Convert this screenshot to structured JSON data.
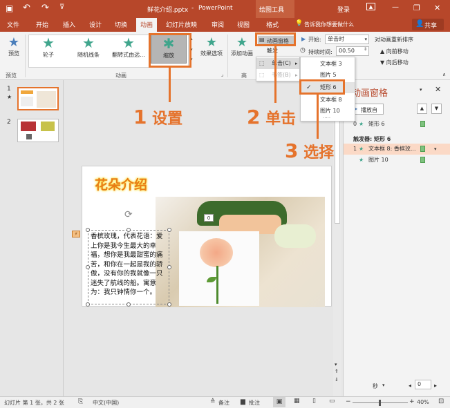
{
  "titlebar": {
    "filename": "鲜花介绍.pptx",
    "sep": "-",
    "app": "PowerPoint",
    "context_tool": "绘图工具",
    "login": "登录",
    "min": "—",
    "restore": "❐",
    "close": "✕",
    "save_icon": "▣",
    "undo": "↶",
    "redo": "↷"
  },
  "tabs": [
    {
      "label": "文件"
    },
    {
      "label": "开始"
    },
    {
      "label": "插入"
    },
    {
      "label": "设计"
    },
    {
      "label": "切换"
    },
    {
      "label": "动画"
    },
    {
      "label": "幻灯片放映"
    },
    {
      "label": "审阅"
    },
    {
      "label": "视图"
    },
    {
      "label": "格式"
    }
  ],
  "tell_me": "告诉我你想要做什么",
  "share": "共享",
  "ribbon": {
    "preview": "预览",
    "preview_group": "预览",
    "gallery": [
      {
        "label": "轮子",
        "color": "#3fa58c"
      },
      {
        "label": "随机线条",
        "color": "#3fa58c"
      },
      {
        "label": "翻转式由远...",
        "color": "#3fa58c"
      },
      {
        "label": "缩放",
        "color": "#3fa58c"
      }
    ],
    "effect_options": "效果选项",
    "anim_group": "动画",
    "add_anim": "添加动画",
    "adv_group": "高",
    "anim_pane_btn": "动画窗格",
    "trigger_btn": "触发",
    "start_label": "开始:",
    "start_value": "单击时",
    "duration_label": "持续时间:",
    "duration_value": "00.50",
    "reorder": "对动画重新排序",
    "move_earlier": "向前移动",
    "move_later": "向后移动"
  },
  "menu": {
    "on_click": "单击(C)",
    "bookmark": "书签(B)",
    "sub_items": [
      {
        "label": "文本框 3"
      },
      {
        "label": "图片 5"
      },
      {
        "label": "矩形 6"
      },
      {
        "label": "文本框 8"
      },
      {
        "label": "图片 10"
      }
    ],
    "more": "....."
  },
  "annotations": {
    "step1_num": "1",
    "step1_text": "设置",
    "step2_num": "2",
    "step2_text": "单击",
    "step3_num": "3",
    "step3_text": "选择"
  },
  "thumbs": {
    "slide1_num": "1",
    "slide1_star": "★",
    "slide2_num": "2"
  },
  "slide": {
    "title": "花朵介绍",
    "anim_tag": "0",
    "text": "香槟玫瑰，代表花语：爱上你是我今生最大的幸福，想你是我最甜蜜的痛苦，和你在一起是我的骄傲，没有你的我就像一只迷失了航线的船。寓意为：我只钟情你一个。"
  },
  "anim_pane": {
    "title": "动画窗格",
    "play_from": "播放自",
    "item0_num": "0",
    "item0_label": "矩形 6",
    "trigger_header": "触发器: 矩形 6",
    "item1_num": "1",
    "item1_label": "文本框 8: 香槟玫...",
    "item2_label": "图片 10",
    "seconds": "秒",
    "page_value": "0"
  },
  "status": {
    "slide_info": "幻灯片 第 1 张，共 2 张",
    "lang": "中文(中国)",
    "notes": "备注",
    "comments": "批注",
    "zoom": "40%"
  }
}
